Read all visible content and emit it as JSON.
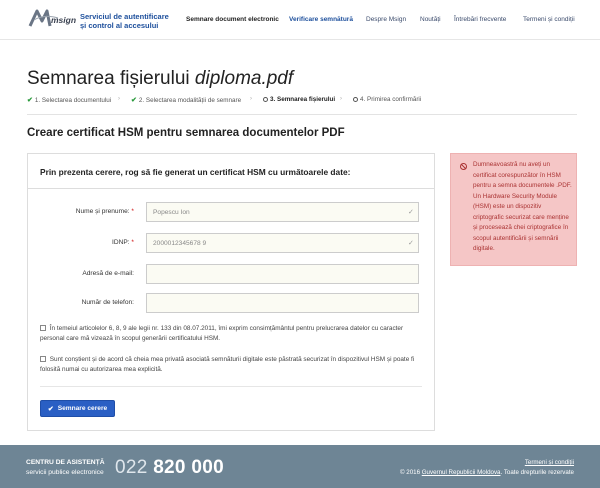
{
  "header": {
    "logo_text": "msign",
    "service_line1": "Serviciul de autentificare",
    "service_line2": "și control al accesului",
    "nav": [
      "Semnare document electronic",
      "Verificare semnătură",
      "Despre Msign",
      "Noutăți",
      "Întrebări frecvente",
      "Termeni și condiții"
    ]
  },
  "page": {
    "title_prefix": "Semnarea fișierului ",
    "title_file": "diploma.pdf",
    "steps": [
      "1. Selectarea documentului",
      "2. Selectarea modalității de semnare",
      "3. Semnarea fișierului",
      "4. Primirea confirmării"
    ],
    "section_title": "Creare certificat HSM pentru semnarea documentelor PDF"
  },
  "form": {
    "heading": "Prin prezenta cerere, rog să fie generat un certificat HSM cu următoarele date:",
    "fields": [
      {
        "label": "Nume și prenume:",
        "required": "*",
        "value": "Popescu Ion"
      },
      {
        "label": "IDNP:",
        "required": "*",
        "value": "2000012345678 9"
      },
      {
        "label": "Adresă de e-mail:",
        "value": ""
      },
      {
        "label": "Număr de telefon:",
        "value": ""
      }
    ],
    "consent1": "În temeiul articolelor 6, 8, 9 ale legii nr. 133 din 08.07.2011, îmi exprim consimțământul pentru prelucrarea datelor cu caracter personal care mă vizează în scopul generării certificatului HSM.",
    "consent2": "Sunt conștient și de acord că cheia mea privată asociată semnăturii digitale este păstrată securizat în dispozitivul HSM și poate fi folosită numai cu autorizarea mea explicită.",
    "submit_label": "Semnare cerere"
  },
  "alert": {
    "text": "Dumneavoastră nu aveți un certificat corespunzător în HSM pentru a semna documentele .PDF. Un Hardware Security Module (HSM) este un dispozitiv criptografic securizat care menține și procesează chei criptografice în scopul autentificării și semnării digitale."
  },
  "footer": {
    "help_line1": "CENTRU DE ASISTENȚĂ",
    "help_line2": "servicii publice electronice",
    "phone_prefix": "022 ",
    "phone_main": "820 000",
    "terms_link": "Termeni și condiții",
    "copyright_prefix": "© 2016 ",
    "government_link": "Guvernul Republicii Moldova",
    "copyright_suffix": ". Toate drepturile rezervate"
  },
  "colors": {
    "brand": "#1d4f9c",
    "button": "#2a5fc4",
    "alert_bg": "#f5c6c6",
    "footer_bg": "#6e8595"
  }
}
